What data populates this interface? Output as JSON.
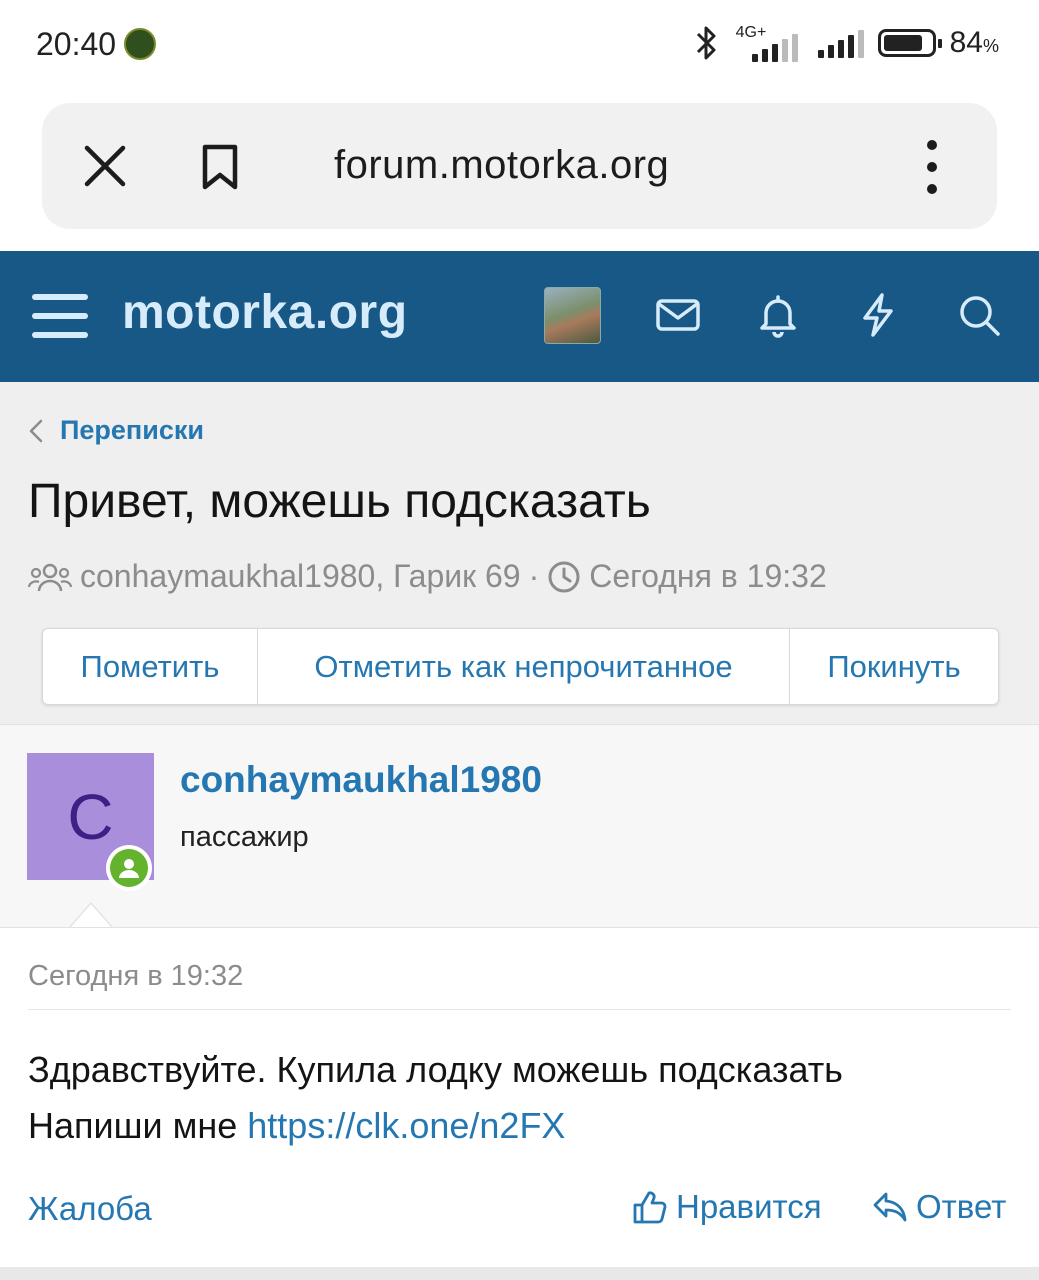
{
  "status_bar": {
    "time": "20:40",
    "network_label": "4G+",
    "battery_value": "84",
    "battery_unit": "%",
    "icons": [
      "bluetooth-icon",
      "signal-icon",
      "battery-icon"
    ]
  },
  "browser": {
    "url": "forum.motorka.org",
    "icons": [
      "close-icon",
      "bookmark-icon",
      "more-vertical-icon"
    ]
  },
  "site_header": {
    "logo": "motorka.org",
    "icons": [
      "menu-icon",
      "mail-icon",
      "bell-icon",
      "lightning-icon",
      "search-icon"
    ],
    "brand_color": "#185886"
  },
  "breadcrumb": {
    "label": "Переписки"
  },
  "conversation": {
    "title": "Привет, можешь подсказать",
    "participants": "conhaymaukhal1980, Гарик 69",
    "separator": "·",
    "time": "Сегодня в 19:32"
  },
  "actions": {
    "mark": "Пометить",
    "mark_unread": "Отметить как непрочитанное",
    "leave": "Покинуть"
  },
  "message": {
    "avatar_letter": "C",
    "username": "conhaymaukhal1980",
    "user_title": "пассажир",
    "date": "Сегодня в 19:32",
    "text_line1": "Здравствуйте. Купила лодку можешь подсказать",
    "text_line2_prefix": "Напиши мне ",
    "link": "https://clk.one/n2FX",
    "report": "Жалоба",
    "like": "Нравится",
    "reply": "Ответ"
  },
  "colors": {
    "link": "#2577b1",
    "avatar_bg": "#a98fdb",
    "online": "#63b32f"
  }
}
